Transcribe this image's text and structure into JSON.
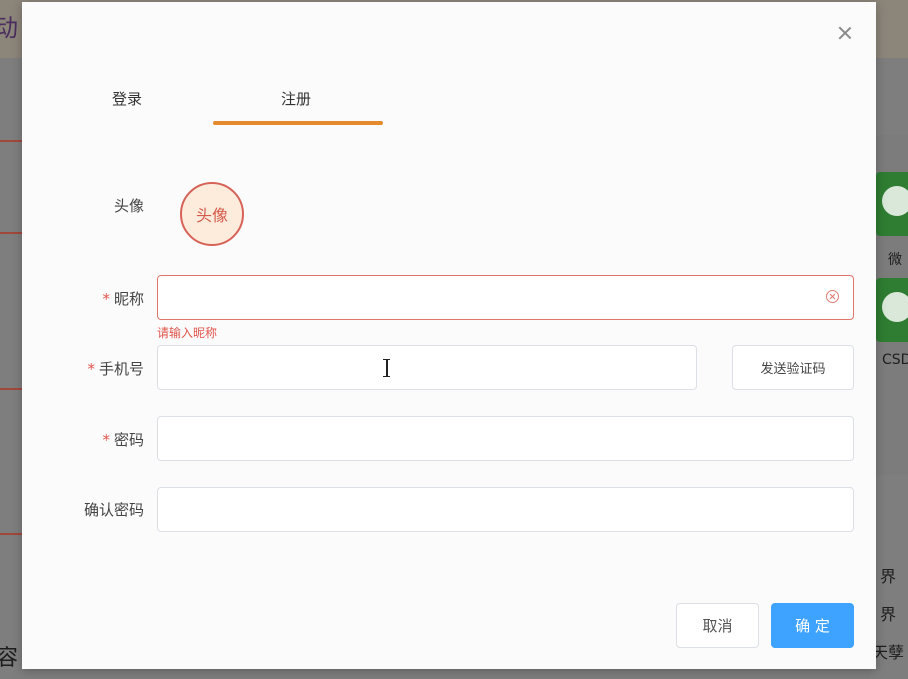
{
  "background": {
    "title_fragment": "动",
    "right_texts": [
      "微",
      "CSD",
      "界",
      "界",
      "天孽"
    ],
    "left_text": "容"
  },
  "dialog": {
    "tabs": [
      {
        "label": "登录",
        "active": false
      },
      {
        "label": "注册",
        "active": true
      }
    ],
    "accent_color": "#e68a2e",
    "avatar": {
      "label": "头像",
      "placeholder": "头像"
    },
    "fields": {
      "nickname": {
        "label": "昵称",
        "required": true,
        "value": "",
        "error": "请输入昵称"
      },
      "phone": {
        "label": "手机号",
        "required": true,
        "value": ""
      },
      "password": {
        "label": "密码",
        "required": true,
        "value": ""
      },
      "confirm_password": {
        "label": "确认密码",
        "required": false,
        "value": ""
      }
    },
    "send_code_button": "发送验证码",
    "cancel_button": "取消",
    "confirm_button": "确 定",
    "required_mark": "*"
  }
}
